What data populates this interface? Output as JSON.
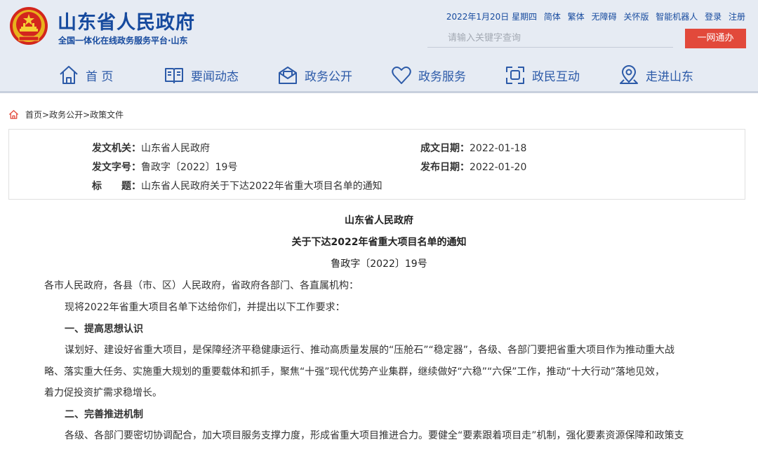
{
  "header": {
    "site_title": "山东省人民政府",
    "site_subtitle": "全国一体化在线政务服务平台·山东",
    "date_text": "2022年1月20日 星期四",
    "links": [
      "简体",
      "繁体",
      "无障碍",
      "关怀版",
      "智能机器人",
      "登录",
      "注册"
    ],
    "search_placeholder": "请输入关键字查询",
    "one_net_button": "一网通办"
  },
  "nav": [
    {
      "label": "首 页",
      "icon": "home-icon"
    },
    {
      "label": "要闻动态",
      "icon": "book-icon"
    },
    {
      "label": "政务公开",
      "icon": "envelope-icon"
    },
    {
      "label": "政务服务",
      "icon": "heart-icon"
    },
    {
      "label": "政民互动",
      "icon": "interact-icon"
    },
    {
      "label": "走进山东",
      "icon": "location-icon"
    }
  ],
  "breadcrumb": {
    "home": "首页",
    "sep": ">",
    "level1": "政务公开",
    "level2": "政策文件"
  },
  "meta": {
    "issuer_label": "发文机关：",
    "issuer_value": "山东省人民政府",
    "doc_no_label": "发文字号：",
    "doc_no_value": "鲁政字〔2022〕19号",
    "title_label": "标　　题：",
    "title_value": "山东省人民政府关于下达2022年省重大项目名单的通知",
    "written_label": "成文日期：",
    "written_value": "2022-01-18",
    "publish_label": "发布日期：",
    "publish_value": "2022-01-20"
  },
  "document": {
    "org": "山东省人民政府",
    "title": "关于下达2022年省重大项目名单的通知",
    "number": "鲁政字〔2022〕19号",
    "addressee": "各市人民政府，各县（市、区）人民政府，省政府各部门、各直属机构：",
    "intro": "现将2022年省重大项目名单下达给你们，并提出以下工作要求：",
    "heading1": "一、提高思想认识",
    "p1_line1": "谋划好、建设好省重大项目，是保障经济平稳健康运行、推动高质量发展的“压舱石”“稳定器”，各级、各部门要把省重大项目作为推动重大战",
    "p1_line2": "略、落实重大任务、实施重大规划的重要载体和抓手，聚焦“十强”现代优势产业集群，继续做好“六稳”“六保”工作，推动“十大行动”落地见效，",
    "p1_line3": "着力促投资扩需求稳增长。",
    "heading2": "二、完善推进机制",
    "p2_line1": "各级、各部门要密切协调配合，加大项目服务支撑力度，形成省重大项目推进合力。要健全“要素跟着项目走”机制，强化要素资源保障和政策支"
  },
  "colors": {
    "brand_blue": "#164a9e",
    "nav_blue": "#2c5aa8",
    "header_bg": "#e6ebf3",
    "button_red": "#e2493b"
  }
}
